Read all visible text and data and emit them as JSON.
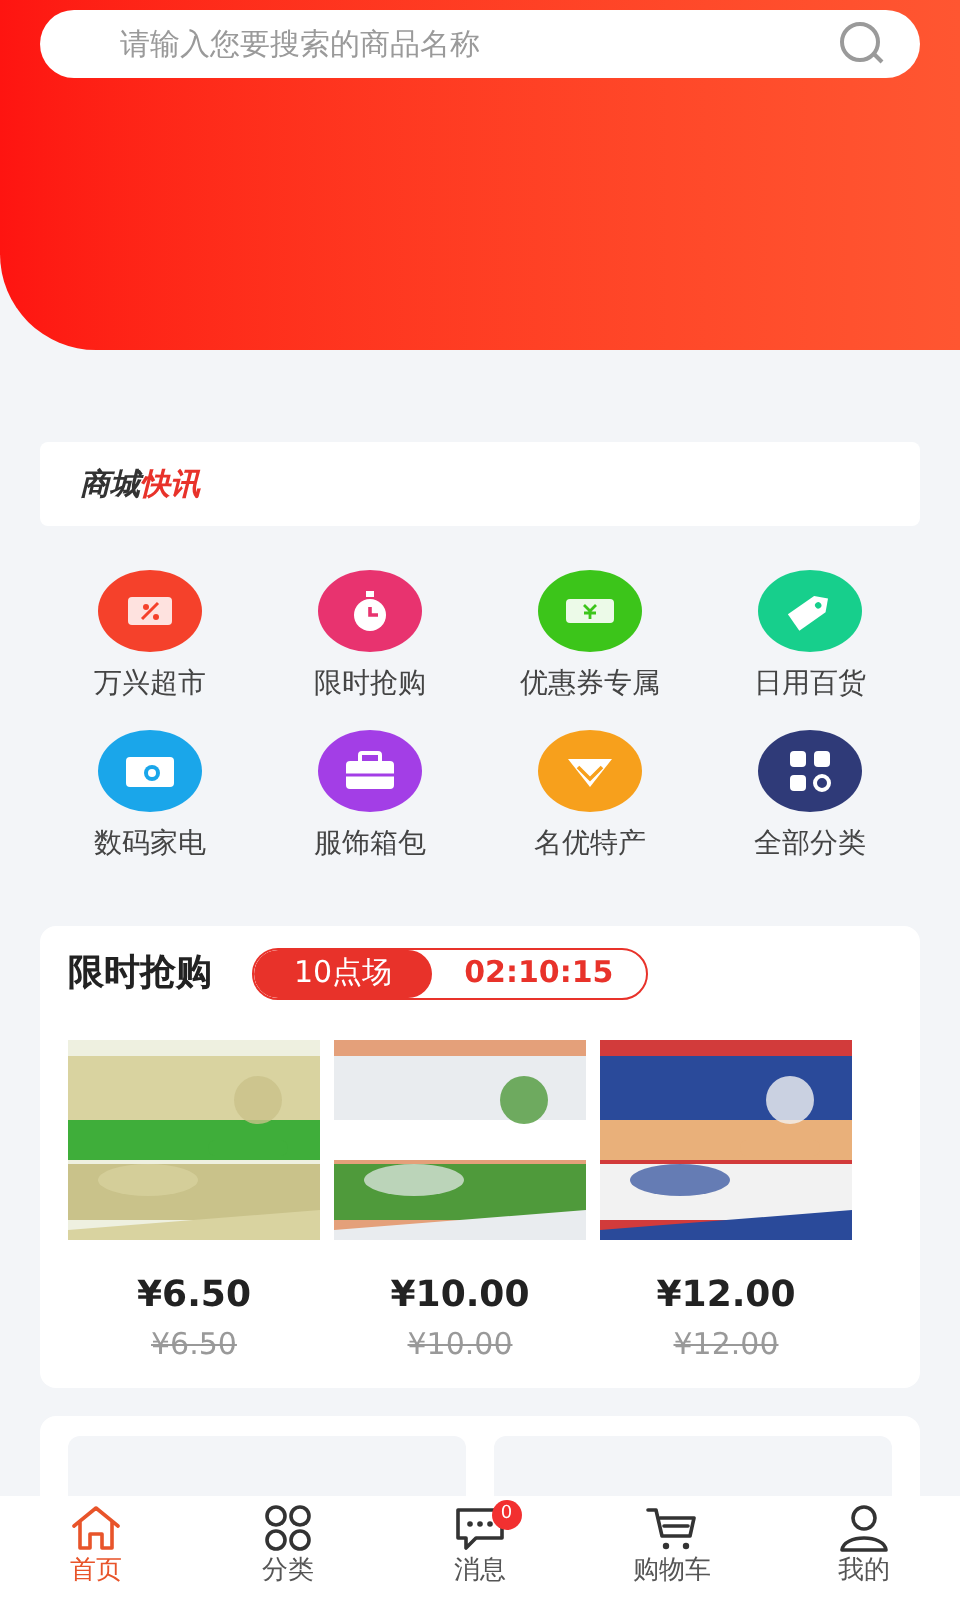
{
  "search": {
    "placeholder": "请输入您要搜索的商品名称"
  },
  "news": {
    "logo_dark": "商城",
    "logo_red": "快讯"
  },
  "categories": [
    {
      "label": "万兴超市",
      "color": "#f5412b",
      "kind": "coupon"
    },
    {
      "label": "限时抢购",
      "color": "#e8336f",
      "kind": "clock"
    },
    {
      "label": "优惠券专属",
      "color": "#3cc51a",
      "kind": "ticket"
    },
    {
      "label": "日用百货",
      "color": "#17cf8c",
      "kind": "tag"
    },
    {
      "label": "数码家电",
      "color": "#1aa6ea",
      "kind": "camera"
    },
    {
      "label": "服饰箱包",
      "color": "#a33ee6",
      "kind": "case"
    },
    {
      "label": "名优特产",
      "color": "#f7a01c",
      "kind": "gem"
    },
    {
      "label": "全部分类",
      "color": "#2f3a78",
      "kind": "grid"
    }
  ],
  "flash_sale": {
    "title": "限时抢购",
    "session": "10点场",
    "countdown": "02:10:15",
    "products": [
      {
        "kind": "picture",
        "price": "¥6.50",
        "original_price": "¥6.50"
      },
      {
        "kind": "picture",
        "price": "¥10.00",
        "original_price": "¥10.00"
      },
      {
        "kind": "picture",
        "price": "¥12.00",
        "original_price": "¥12.00"
      }
    ]
  },
  "promo_cards": [
    {
      "kind": "card"
    },
    {
      "kind": "card"
    }
  ],
  "nav": [
    {
      "label": "首页",
      "kind": "home",
      "selected": true
    },
    {
      "label": "分类",
      "kind": "grid",
      "selected": false
    },
    {
      "label": "消息",
      "kind": "chat",
      "selected": false,
      "badge": "0"
    },
    {
      "label": "购物车",
      "kind": "cart",
      "selected": false
    },
    {
      "label": "我的",
      "kind": "user",
      "selected": false
    }
  ]
}
